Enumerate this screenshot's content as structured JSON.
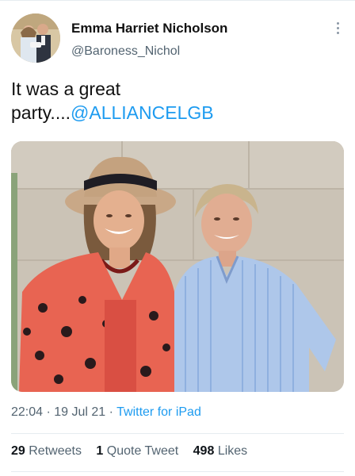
{
  "author": {
    "name": "Emma Harriet Nicholson",
    "handle": "@Baroness_Nichol"
  },
  "tweet": {
    "text_line1": "It was a great",
    "text_line2_prefix": "party....",
    "mention": "@ALLIANCELGB"
  },
  "meta": {
    "time": "22:04",
    "separator1": " · ",
    "date": "19 Jul 21",
    "separator2": " · ",
    "source": "Twitter for iPad"
  },
  "stats": {
    "retweets_count": "29",
    "retweets_label": "Retweets",
    "quotes_count": "1",
    "quotes_label": "Quote Tweet",
    "likes_count": "498",
    "likes_label": "Likes"
  },
  "colors": {
    "accent": "#1d9bf0",
    "secondary_text": "#536471"
  }
}
